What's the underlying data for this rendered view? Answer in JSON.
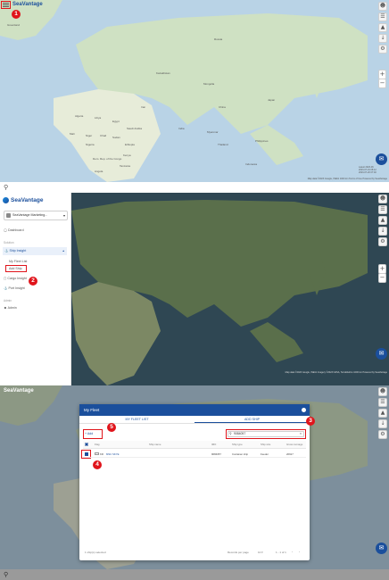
{
  "brand": {
    "name": "SeaVantage"
  },
  "annotations": {
    "n1": "1",
    "n2": "2",
    "n3": "3",
    "n4": "4",
    "n5": "5"
  },
  "map_labels": {
    "greenland": "Greenland",
    "russia": "Russia",
    "kazakhstan": "Kazakhstan",
    "mongolia": "Mongolia",
    "china": "China",
    "india": "India",
    "algeria": "Algeria",
    "libya": "Libya",
    "egypt": "Egypt",
    "saudi": "Saudi Arabia",
    "iran": "Iran",
    "mali": "Mali",
    "niger": "Niger",
    "sudan": "Sudan",
    "chad": "Chad",
    "ethiopia": "Ethiopia",
    "nigeria": "Nigeria",
    "drc": "Dem. Rep. of the Congo",
    "kenya": "Kenya",
    "tanzania": "Tanzania",
    "angola": "Angola",
    "pakistan": "Pakistan",
    "myanmar": "Myanmar",
    "thailand": "Thailand",
    "japan": "Japan",
    "philippines": "Philippines",
    "indonesia": "Indonesia"
  },
  "map_attribution": "Map data ©2023 Google, INEGI   1000 km   Terms of Use   Powered by SeaVantage",
  "map_attribution_dark": "Map data ©2023 Google, INEGI   Imagery ©2023 NASA, TerraMetrics   1000 km   Powered by SeaVantage",
  "map_info": [
    "Latest 2023-06",
    "2023-07-19 08:12",
    "2023-07-20 07:40"
  ],
  "sidebar": {
    "workspace": "SeaVantage Marketing...",
    "dashboard": "Dashboard",
    "section_solution": "Solution",
    "ship_insight": "Ship Insight",
    "my_fleet_list": "My Fleet List",
    "add_ship": "Add Ship",
    "cargo_insight": "Cargo Insight",
    "port_insight": "Port Insight",
    "section_admin": "Admin",
    "admin": "Admin"
  },
  "dialog": {
    "title": "My Fleet",
    "tab_list": "MY FLEET LIST",
    "tab_add": "ADD SHIP",
    "search_value": "9084057",
    "add_label": "Add",
    "headers": [
      "Flag",
      "Ship name",
      "IMO",
      "Ship type",
      "Ship size",
      "Gross tonnage"
    ],
    "row": {
      "flag": "KR",
      "ship_name": "MSC SKYE",
      "imo": "9084057",
      "ship_type": "Container ship",
      "ship_size": "Feeder",
      "gross_tonnage": "20917"
    },
    "footer_selected": "1 ship(s) selected",
    "rows_per_page_label": "Records per page",
    "rows_per_page": "10",
    "pagination": "1 - 1 of 1"
  },
  "colors": {
    "brand": "#1b4f9c",
    "annotation": "#e0141b"
  }
}
